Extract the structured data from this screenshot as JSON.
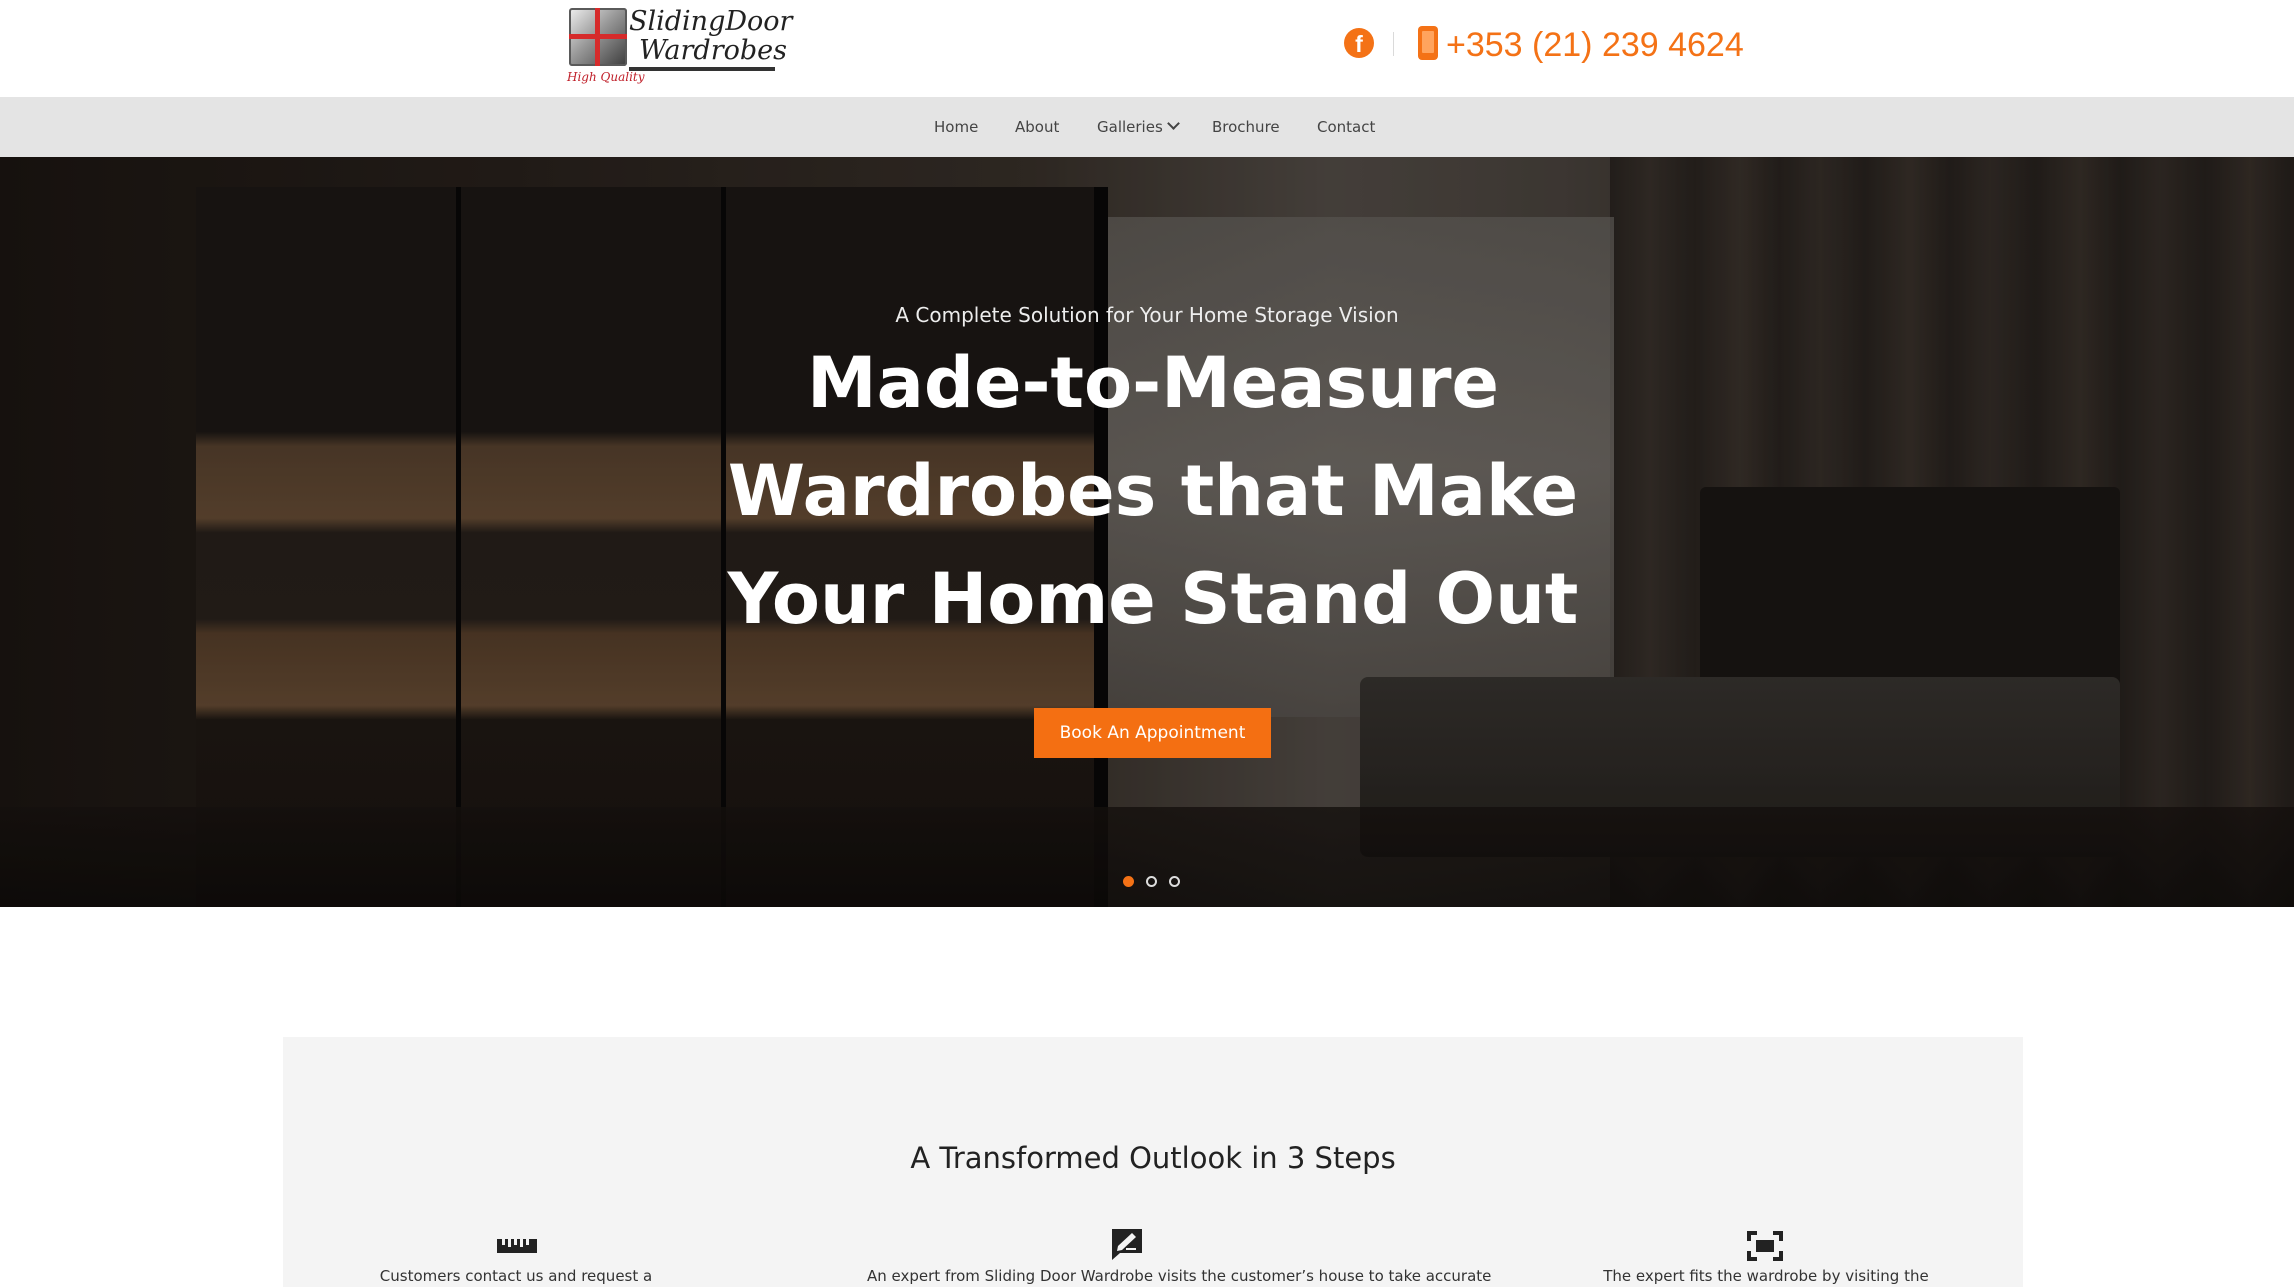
{
  "brand": {
    "line1": "SlidingDoor",
    "line2": "Wardrobes",
    "tagline": "High Quality",
    "accent": "#f47216"
  },
  "header": {
    "facebook_icon": "f",
    "phone": "+353 (21) 239 4624"
  },
  "nav": {
    "items": [
      {
        "label": "Home"
      },
      {
        "label": "About"
      },
      {
        "label": "Galleries"
      },
      {
        "label": "Brochure"
      },
      {
        "label": "Contact"
      }
    ]
  },
  "hero": {
    "subtitle": "A Complete Solution for Your Home Storage Vision",
    "title_lines": [
      "Made-to-Measure",
      "Wardrobes that Make",
      "Your Home Stand Out"
    ],
    "cta": "Book An Appointment",
    "slides": 3,
    "active_slide": 1
  },
  "steps": {
    "title": "A Transformed Outlook in 3 Steps",
    "items": [
      {
        "icon": "ruler-icon",
        "text": "Customers contact us and request a"
      },
      {
        "icon": "signature-icon",
        "text": "An expert from Sliding Door Wardrobe visits the customer’s house to take accurate"
      },
      {
        "icon": "expand-icon",
        "text": "The expert fits the wardrobe by visiting the"
      }
    ]
  }
}
